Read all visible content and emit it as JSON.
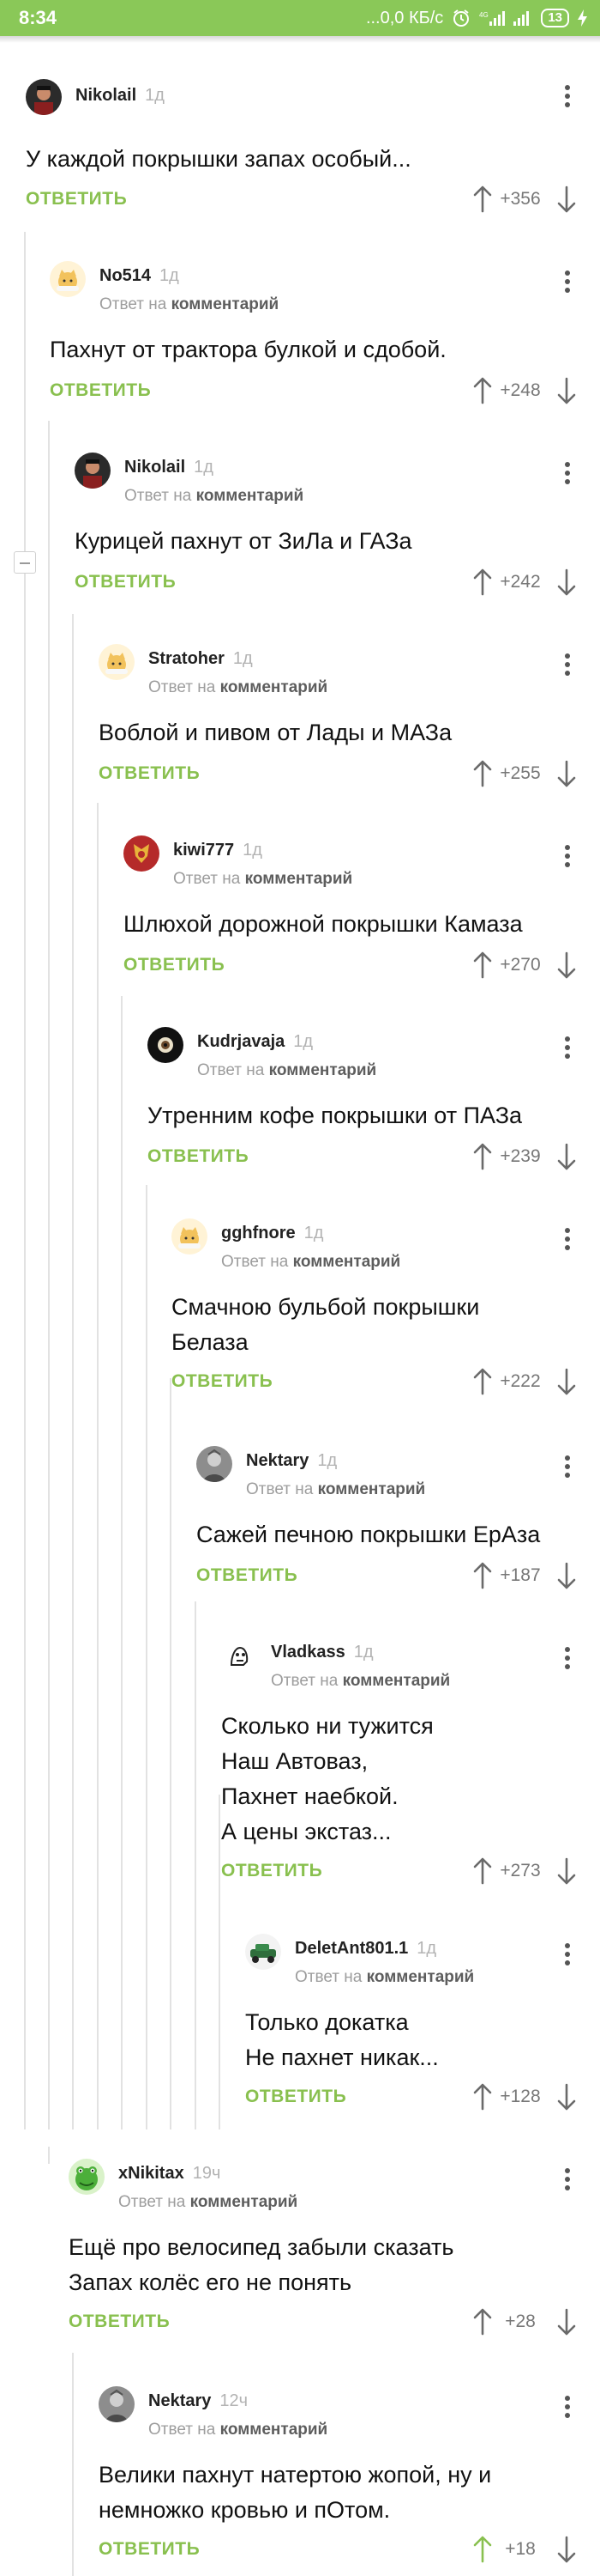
{
  "status_bar": {
    "time": "8:34",
    "network_speed": "...0,0 КБ/с",
    "network_type": "4G",
    "battery": "13",
    "icons": [
      "alarm-icon",
      "signal-icon",
      "signal-icon",
      "battery-icon",
      "charging-icon"
    ]
  },
  "common": {
    "reply_label": "ОТВЕТИТЬ",
    "reply_to_prefix": "Ответ на",
    "reply_to_link": "комментарий"
  },
  "colors": {
    "status_bar": "#8ac858",
    "reply_button": "#89c04f",
    "vote_up_active": "#89c04f",
    "text": "#111111",
    "muted": "#9d9d9d"
  },
  "comments": [
    {
      "author": "Nikolail",
      "age": "1д",
      "avatar": "nikolail-avatar",
      "text": [
        "У каждой покрышки запах особый..."
      ],
      "score": "+356"
    },
    {
      "author": "No514",
      "age": "1д",
      "avatar": "cat-avatar",
      "text": [
        "Пахнут от трактора булкой и сдобой."
      ],
      "score": "+248"
    },
    {
      "author": "Nikolail",
      "age": "1д",
      "avatar": "nikolail-avatar",
      "text": [
        "Курицей пахнут от ЗиЛа и ГАЗа"
      ],
      "score": "+242"
    },
    {
      "author": "Stratoher",
      "age": "1д",
      "avatar": "cat-avatar",
      "text": [
        "Воблой и пивом от Лады и МАЗа"
      ],
      "score": "+255"
    },
    {
      "author": "kiwi777",
      "age": "1д",
      "avatar": "kiwi-avatar",
      "text": [
        "Шлюхой дорожной покрышки Камаза"
      ],
      "score": "+270"
    },
    {
      "author": "Kudrjavaja",
      "age": "1д",
      "avatar": "kudrjavaja-avatar",
      "text": [
        "Утренним кофе покрышки от ПАЗа"
      ],
      "score": "+239"
    },
    {
      "author": "gghfnore",
      "age": "1д",
      "avatar": "cat-avatar",
      "text": [
        "Смачною бульбой покрышки",
        "Белаза"
      ],
      "score": "+222"
    },
    {
      "author": "Nektary",
      "age": "1д",
      "avatar": "nektary-avatar",
      "text": [
        "Сажей печною покрышки ЕрАза"
      ],
      "score": "+187"
    },
    {
      "author": "Vladkass",
      "age": "1д",
      "avatar": "vladkass-avatar",
      "text": [
        "Сколько ни тужится",
        "Наш Автоваз,",
        "Пахнет наебкой.",
        "А цены экстаз..."
      ],
      "score": "+273"
    },
    {
      "author": "DeletAnt801.1",
      "age": "1д",
      "avatar": "deletant-avatar",
      "text": [
        "Только докатка",
        "Не пахнет никак..."
      ],
      "score": "+128"
    },
    {
      "author": "xNikitax",
      "age": "19ч",
      "avatar": "frog-avatar",
      "text": [
        "Ещё про велосипед забыли сказать",
        "Запах колёс его не понять"
      ],
      "score": "+28"
    },
    {
      "author": "Nektary",
      "age": "12ч",
      "avatar": "nektary-avatar",
      "text": [
        "Велики пахнут натертою жопой, ну и",
        "немножко кровью и пОтом."
      ],
      "score": "+18",
      "upvoted": true
    }
  ]
}
